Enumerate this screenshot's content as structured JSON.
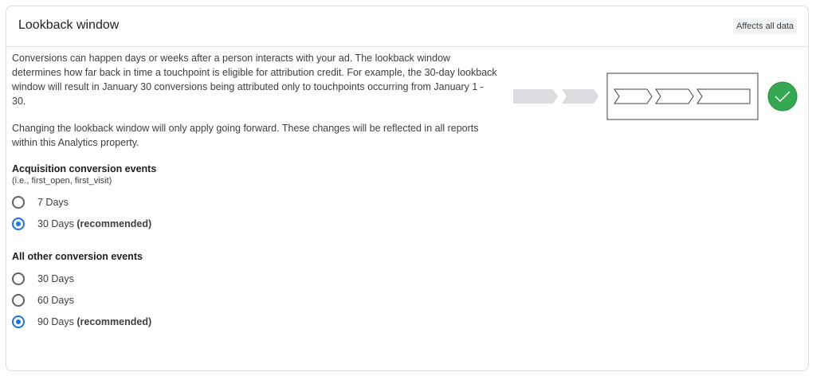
{
  "header": {
    "title": "Lookback window",
    "badge": "Affects all data"
  },
  "description": {
    "p1": "Conversions can happen days or weeks after a person interacts with your ad. The lookback window determines how far back in time a touchpoint is eligible for attribution credit. For example, the 30-day lookback window will result in January 30 conversions being attributed only to touchpoints occurring from January 1 - 30.",
    "p2": "Changing the lookback window will only apply going forward. These changes will be reflected in all reports within this Analytics property."
  },
  "acquisition": {
    "title": "Acquisition conversion events",
    "subtitle": "(i.e., first_open, first_visit)",
    "options": [
      {
        "label": "7 Days",
        "suffix": "",
        "selected": false
      },
      {
        "label": "30 Days",
        "suffix": "(recommended)",
        "selected": true
      }
    ]
  },
  "other": {
    "title": "All other conversion events",
    "options": [
      {
        "label": "30 Days",
        "suffix": "",
        "selected": false
      },
      {
        "label": "60 Days",
        "suffix": "",
        "selected": false
      },
      {
        "label": "90 Days",
        "suffix": "(recommended)",
        "selected": true
      }
    ]
  },
  "colors": {
    "accent": "#1a73e8",
    "success": "#34a853",
    "chevron_gray": "#dadce0"
  }
}
